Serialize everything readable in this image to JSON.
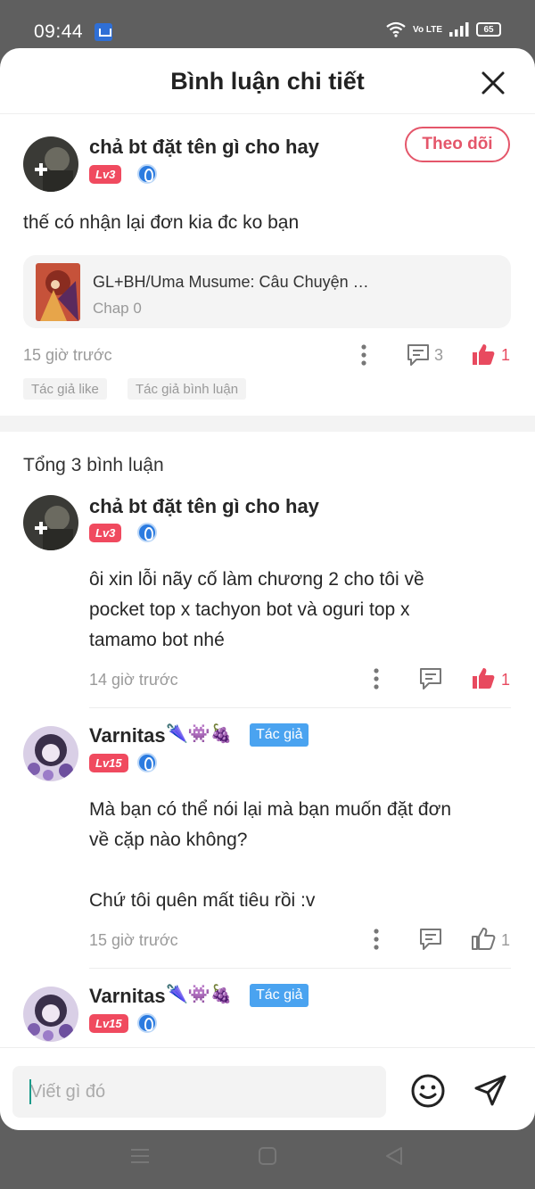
{
  "status_bar": {
    "time": "09:44",
    "network": "Vo LTE",
    "battery": "65"
  },
  "header": {
    "title": "Bình luận chi tiết"
  },
  "main_comment": {
    "username": "chả bt đặt tên gì cho hay",
    "level": "Lv3",
    "follow_label": "Theo dõi",
    "text": "thế có nhận lại đơn kia đc ko bạn",
    "story": {
      "title": "GL+BH/Uma Musume: Câu Chuyện …",
      "chapter": "Chap 0"
    },
    "time": "15 giờ trước",
    "reply_count": "3",
    "like_count": "1",
    "chips": [
      "Tác giả like",
      "Tác giả bình luận"
    ]
  },
  "total_label": "Tổng 3 bình luận",
  "replies": [
    {
      "username": "chả bt đặt tên gì cho hay",
      "level": "Lv3",
      "lines": [
        "ôi xin lỗi nãy cố làm chương 2 cho tôi về",
        "pocket top x tachyon bot và oguri top x",
        "tamamo bot nhé"
      ],
      "time": "14 giờ trước",
      "like_count": "1",
      "liked": true
    },
    {
      "username": "Varnitas",
      "level": "Lv15",
      "author_tag": "Tác giả",
      "lines": [
        "Mà bạn có thể nói lại mà bạn muốn đặt đơn",
        "về cặp nào không?",
        "",
        "Chứ tôi quên mất tiêu rồi :v"
      ],
      "time": "15 giờ trước",
      "like_count": "1",
      "liked": false
    },
    {
      "username": "Varnitas",
      "level": "Lv15",
      "author_tag": "Tác giả"
    }
  ],
  "composer": {
    "placeholder": "Viết gì đó"
  },
  "colors": {
    "accent": "#e84a5f",
    "author_tag": "#4aa3f0",
    "level_badge": "#f04a5f"
  },
  "icons": [
    "close-icon",
    "more-icon",
    "comment-icon",
    "thumbs-up-icon",
    "emoji-icon",
    "send-icon",
    "menu-icon",
    "home-icon",
    "back-icon"
  ]
}
